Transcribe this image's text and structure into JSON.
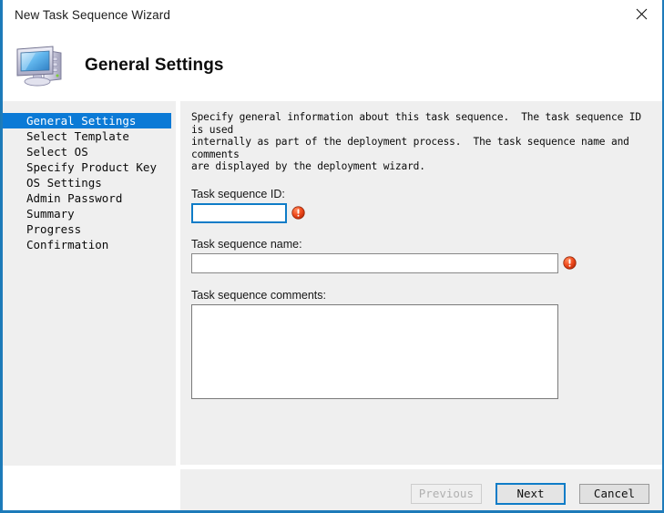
{
  "window": {
    "title": "New Task Sequence Wizard",
    "close_icon": "close-icon",
    "frame_color": "#1e7bba"
  },
  "header": {
    "icon": "computer-monitor-icon",
    "title": "General Settings"
  },
  "sidebar": {
    "selected_index": 0,
    "highlight_color": "#0b7ad6",
    "items": [
      {
        "label": "General Settings"
      },
      {
        "label": "Select Template"
      },
      {
        "label": "Select OS"
      },
      {
        "label": "Specify Product Key"
      },
      {
        "label": "OS Settings"
      },
      {
        "label": "Admin Password"
      },
      {
        "label": "Summary"
      },
      {
        "label": "Progress"
      },
      {
        "label": "Confirmation"
      }
    ]
  },
  "content": {
    "description": "Specify general information about this task sequence.  The task sequence ID is used\ninternally as part of the deployment process.  The task sequence name and comments\nare displayed by the deployment wizard.",
    "fields": {
      "task_sequence_id": {
        "label": "Task sequence ID:",
        "value": "",
        "placeholder": "",
        "error_icon": "error-exclamation-icon",
        "focused": true
      },
      "task_sequence_name": {
        "label": "Task sequence name:",
        "value": "",
        "placeholder": "",
        "error_icon": "error-exclamation-icon",
        "focused": false
      },
      "task_sequence_comments": {
        "label": "Task sequence comments:",
        "value": "",
        "placeholder": ""
      }
    },
    "error_color": "#e03a15"
  },
  "footer": {
    "previous_label": "Previous",
    "next_label": "Next",
    "cancel_label": "Cancel"
  }
}
